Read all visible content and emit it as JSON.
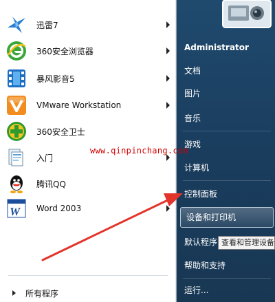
{
  "programs": [
    {
      "label": "迅雷7",
      "icon": "xunlei-bird-icon",
      "has_submenu": true
    },
    {
      "label": "360安全浏览器",
      "icon": "360-browser-icon",
      "has_submenu": true
    },
    {
      "label": "暴风影音5",
      "icon": "baofeng-film-icon",
      "has_submenu": true
    },
    {
      "label": "VMware Workstation",
      "icon": "vmware-icon",
      "has_submenu": true
    },
    {
      "label": "360安全卫士",
      "icon": "360-safeguard-icon",
      "has_submenu": false
    },
    {
      "label": "入门",
      "icon": "getting-started-icon",
      "has_submenu": true
    },
    {
      "label": "腾讯QQ",
      "icon": "qq-penguin-icon",
      "has_submenu": false
    },
    {
      "label": "Word 2003",
      "icon": "word-icon",
      "has_submenu": true
    }
  ],
  "all_programs_label": "所有程序",
  "right_items": {
    "user": "Administrator",
    "documents": "文档",
    "pictures": "图片",
    "music": "音乐",
    "games": "游戏",
    "computer": "计算机",
    "control_panel": "控制面板",
    "devices_printers": "设备和打印机",
    "default_programs": "默认程序",
    "help_support": "帮助和支持",
    "run": "运行..."
  },
  "tooltip": "查看和管理设备",
  "watermark": "www.qinpinchang.com",
  "colors": {
    "right_pane": "#1f4a6e",
    "arrow": "#e3342b",
    "watermark": "#d10000"
  }
}
